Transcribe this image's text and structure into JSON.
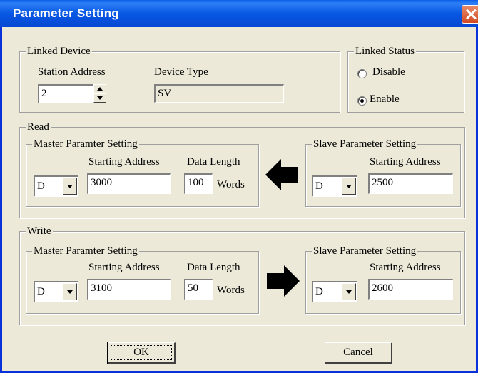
{
  "window": {
    "title": "Parameter Setting"
  },
  "linked_device": {
    "legend": "Linked Device",
    "station_address_label": "Station Address",
    "station_address_value": "2",
    "device_type_label": "Device Type",
    "device_type_value": "SV"
  },
  "linked_status": {
    "legend": "Linked Status",
    "options": [
      {
        "label": "Disable",
        "selected": false
      },
      {
        "label": "Enable",
        "selected": true
      }
    ]
  },
  "read": {
    "legend": "Read",
    "master": {
      "legend": "Master Paramter Setting",
      "starting_address_label": "Starting Address",
      "data_length_label": "Data Length",
      "device": "D",
      "starting_address": "3000",
      "data_length": "100",
      "unit": "Words"
    },
    "slave": {
      "legend": "Slave Parameter Setting",
      "starting_address_label": "Starting Address",
      "device": "D",
      "starting_address": "2500"
    }
  },
  "write": {
    "legend": "Write",
    "master": {
      "legend": "Master Paramter Setting",
      "starting_address_label": "Starting Address",
      "data_length_label": "Data Length",
      "device": "D",
      "starting_address": "3100",
      "data_length": "50",
      "unit": "Words"
    },
    "slave": {
      "legend": "Slave Parameter Setting",
      "starting_address_label": "Starting Address",
      "device": "D",
      "starting_address": "2600"
    }
  },
  "buttons": {
    "ok": "OK",
    "cancel": "Cancel"
  },
  "colors": {
    "titlebar": "#0857e3",
    "dialog": "#ece9d8",
    "close": "#d24a21"
  }
}
